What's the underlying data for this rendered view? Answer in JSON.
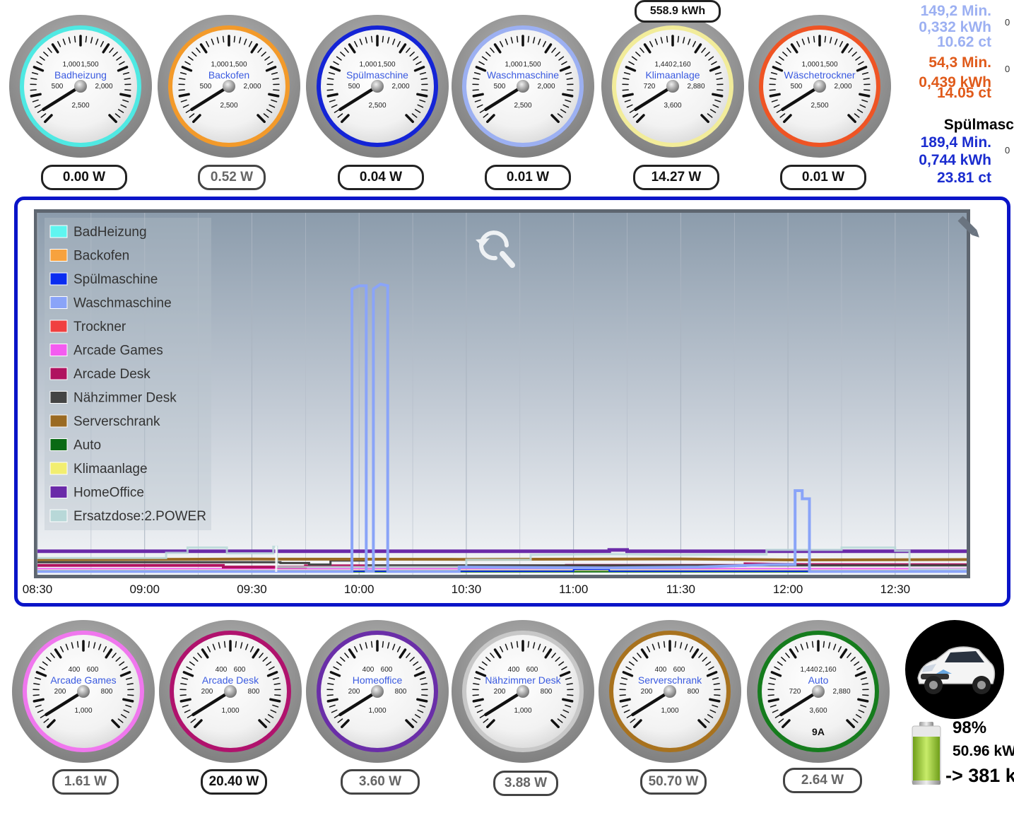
{
  "top_gauges": [
    {
      "name": "Badheizung",
      "ring": "#4fe9e3",
      "ticks": [
        "1,000",
        "1,500",
        "500",
        "2,000",
        "2,500"
      ],
      "value": "0.00 W",
      "dim": false
    },
    {
      "name": "Backofen",
      "ring": "#f39a2a",
      "ticks": [
        "1,000",
        "1,500",
        "500",
        "2,000",
        "2,500"
      ],
      "value": "0.52 W",
      "dim": true
    },
    {
      "name": "Spülmaschine",
      "ring": "#1424d6",
      "ticks": [
        "1,000",
        "1,500",
        "500",
        "2,000",
        "2,500"
      ],
      "value": "0.04 W",
      "dim": false
    },
    {
      "name": "Waschmaschine",
      "ring": "#9cb0f2",
      "ticks": [
        "1,000",
        "1,500",
        "500",
        "2,000",
        "2,500"
      ],
      "value": "0.01 W",
      "dim": false
    },
    {
      "name": "Klimaanlage",
      "ring": "#f2ec9a",
      "ticks": [
        "1,440",
        "2,160",
        "720",
        "2,880",
        "3,600"
      ],
      "value": "14.27 W",
      "dim": false
    },
    {
      "name": "Wäschetrockner",
      "ring": "#ef5424",
      "ticks": [
        "1,000",
        "1,500",
        "500",
        "2,000",
        "2,500"
      ],
      "value": "0.01 W",
      "dim": false
    }
  ],
  "bottom_gauges": [
    {
      "name": "Arcade Games",
      "ring": "#f077ee",
      "ticks": [
        "400",
        "600",
        "200",
        "800",
        "1,000"
      ],
      "value": "1.61 W",
      "dim": true,
      "extra": ""
    },
    {
      "name": "Arcade Desk",
      "ring": "#b0126d",
      "ticks": [
        "400",
        "600",
        "200",
        "800",
        "1,000"
      ],
      "value": "20.40 W",
      "dim": false,
      "extra": ""
    },
    {
      "name": "Homeoffice",
      "ring": "#6a2ea8",
      "ticks": [
        "400",
        "600",
        "200",
        "800",
        "1,000"
      ],
      "value": "3.60 W",
      "dim": true,
      "extra": ""
    },
    {
      "name": "Nähzimmer Desk",
      "ring": "#c8c8c8",
      "ticks": [
        "400",
        "600",
        "200",
        "800",
        "1,000"
      ],
      "value": "3.88 W",
      "dim": true,
      "extra": ""
    },
    {
      "name": "Serverschrank",
      "ring": "#a8721e",
      "ticks": [
        "400",
        "600",
        "200",
        "800",
        "1,000"
      ],
      "value": "50.70 W",
      "dim": true,
      "extra": ""
    },
    {
      "name": "Auto",
      "ring": "#157c1d",
      "ticks": [
        "1,440",
        "2,160",
        "720",
        "2,880",
        "3,600"
      ],
      "value": "2.64 W",
      "dim": true,
      "extra": "9A"
    }
  ],
  "klima_total": "558.9 kWh",
  "stats": {
    "wasch": {
      "color": "#9cb0f2",
      "lines": [
        "149,2 Min.",
        "0,332 kWh",
        "10.62 ct"
      ]
    },
    "trock": {
      "color": "#e05a1a",
      "lines": [
        "54,3 Min.",
        "0,439 kWh",
        "14.05 ct"
      ]
    },
    "spuel": {
      "title": "Spülmasc",
      "color": "#1a2ccf",
      "lines": [
        "189,4 Min.",
        "0,744 kWh",
        "23.81 ct"
      ]
    },
    "clipped": [
      "0",
      "0",
      "0"
    ]
  },
  "chart_data": {
    "type": "line",
    "x_ticks": [
      "08:30",
      "09:00",
      "09:30",
      "10:00",
      "10:30",
      "11:00",
      "11:30",
      "12:00",
      "12:30"
    ],
    "x_range_min": [
      0,
      260
    ],
    "series": [
      {
        "name": "BadHeizung",
        "color": "#5ff5f0"
      },
      {
        "name": "Backofen",
        "color": "#f7a23e"
      },
      {
        "name": "Spülmaschine",
        "color": "#0a2cf0"
      },
      {
        "name": "Waschmaschine",
        "color": "#8aa4f8"
      },
      {
        "name": "Trockner",
        "color": "#f04040"
      },
      {
        "name": "Arcade Games",
        "color": "#f45cf0"
      },
      {
        "name": "Arcade Desk",
        "color": "#b0125f"
      },
      {
        "name": "Nähzimmer Desk",
        "color": "#444444"
      },
      {
        "name": "Serverschrank",
        "color": "#9a6a22"
      },
      {
        "name": "Auto",
        "color": "#0a6a14"
      },
      {
        "name": "Klimaanlage",
        "color": "#f2ee70"
      },
      {
        "name": "HomeOffice",
        "color": "#6a2aa8"
      },
      {
        "name": "Ersatzdose:2.POWER",
        "color": "#b8d8d8"
      }
    ],
    "legend_position": "top-left",
    "grid": true
  },
  "battery": {
    "percent": "98%",
    "energy": "50.96 kW",
    "range": "-> 381 k"
  }
}
